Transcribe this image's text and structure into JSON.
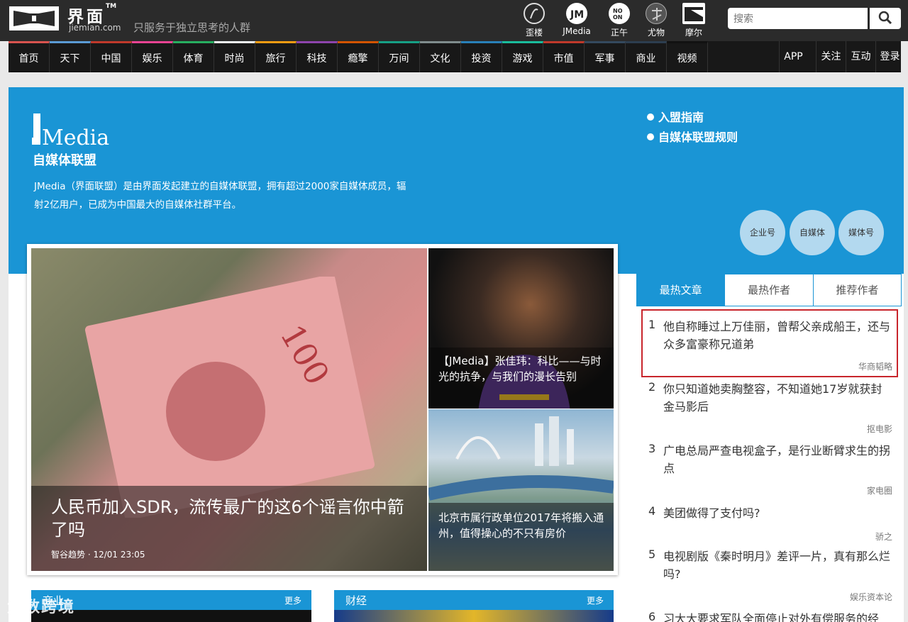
{
  "brand": {
    "cn": "界面",
    "tm": "TM",
    "en": "jiemian.com",
    "slogan": "只服务于独立思考的人群"
  },
  "channels": [
    {
      "label": "歪楼",
      "icon": "wailou-icon"
    },
    {
      "label": "JMedia",
      "icon": "jmedia-icon"
    },
    {
      "label": "正午",
      "icon": "zhengwu-icon"
    },
    {
      "label": "尤物",
      "icon": "youwu-icon"
    },
    {
      "label": "摩尔",
      "icon": "moer-icon"
    }
  ],
  "search": {
    "placeholder": "搜索"
  },
  "nav": [
    {
      "label": "首页",
      "color": "#d9534f"
    },
    {
      "label": "天下",
      "color": "#5b9bd5"
    },
    {
      "label": "中国",
      "color": "#c0392b"
    },
    {
      "label": "娱乐",
      "color": "#e84393"
    },
    {
      "label": "体育",
      "color": "#27ae60"
    },
    {
      "label": "时尚",
      "color": "#ecf0f1"
    },
    {
      "label": "旅行",
      "color": "#f39c12"
    },
    {
      "label": "科技",
      "color": "#8e44ad"
    },
    {
      "label": "瘾擎",
      "color": "#d35400"
    },
    {
      "label": "万间",
      "color": "#16a085"
    },
    {
      "label": "文化",
      "color": "#7f8c8d"
    },
    {
      "label": "投资",
      "color": "#2980b9"
    },
    {
      "label": "游戏",
      "color": "#1abc9c"
    },
    {
      "label": "市值",
      "color": "#c0392b"
    },
    {
      "label": "军事",
      "color": "#34495e"
    },
    {
      "label": "商业",
      "color": "#2c3e50"
    },
    {
      "label": "视频",
      "color": "#111111"
    }
  ],
  "nav_util": [
    "APP",
    "关注",
    "互动",
    "登录"
  ],
  "hero": {
    "logo": "JMedia",
    "subtitle": "自媒体联盟",
    "desc": "JMedia（界面联盟）是由界面发起建立的自媒体联盟，拥有超过2000家自媒体成员，辐射2亿用户，已成为中国最大的自媒体社群平台。",
    "links": [
      "入盟指南",
      "自媒体联盟规则"
    ],
    "buttons": [
      "企业号",
      "自媒体",
      "媒体号"
    ]
  },
  "feature": {
    "main": {
      "title": "人民币加入SDR，流传最广的这6个谣言你中箭了吗",
      "source": "智谷趋势",
      "time": "12/01 23:05"
    },
    "side": [
      {
        "title": "【JMedia】张佳玮：科比——与时光的抗争，与我们的漫长告别"
      },
      {
        "title": "北京市属行政单位2017年将搬入通州，值得操心的不只有房价"
      }
    ]
  },
  "tabs": [
    "最热文章",
    "最热作者",
    "推荐作者"
  ],
  "ranking": [
    {
      "num": "1",
      "title": "他自称睡过上万佳丽，曾帮父亲成船王，还与众多富豪称兄道弟",
      "source": "华商韬略"
    },
    {
      "num": "2",
      "title": "你只知道她卖胸整容，不知道她17岁就获封金马影后",
      "source": "抠电影"
    },
    {
      "num": "3",
      "title": "广电总局严查电视盒子，是行业断臂求生的拐点",
      "source": "家电圈"
    },
    {
      "num": "4",
      "title": "美团做得了支付吗?",
      "source": "骄之"
    },
    {
      "num": "5",
      "title": "电视剧版《秦时明月》差评一片，真有那么烂吗?",
      "source": "娱乐资本论"
    },
    {
      "num": "6",
      "title": "习大大要求军队全面停止对外有偿服务的经",
      "source": ""
    }
  ],
  "sections": [
    {
      "title": "商业",
      "more": "更多"
    },
    {
      "title": "财经",
      "more": "更多"
    }
  ],
  "watermark": "大数跨境"
}
